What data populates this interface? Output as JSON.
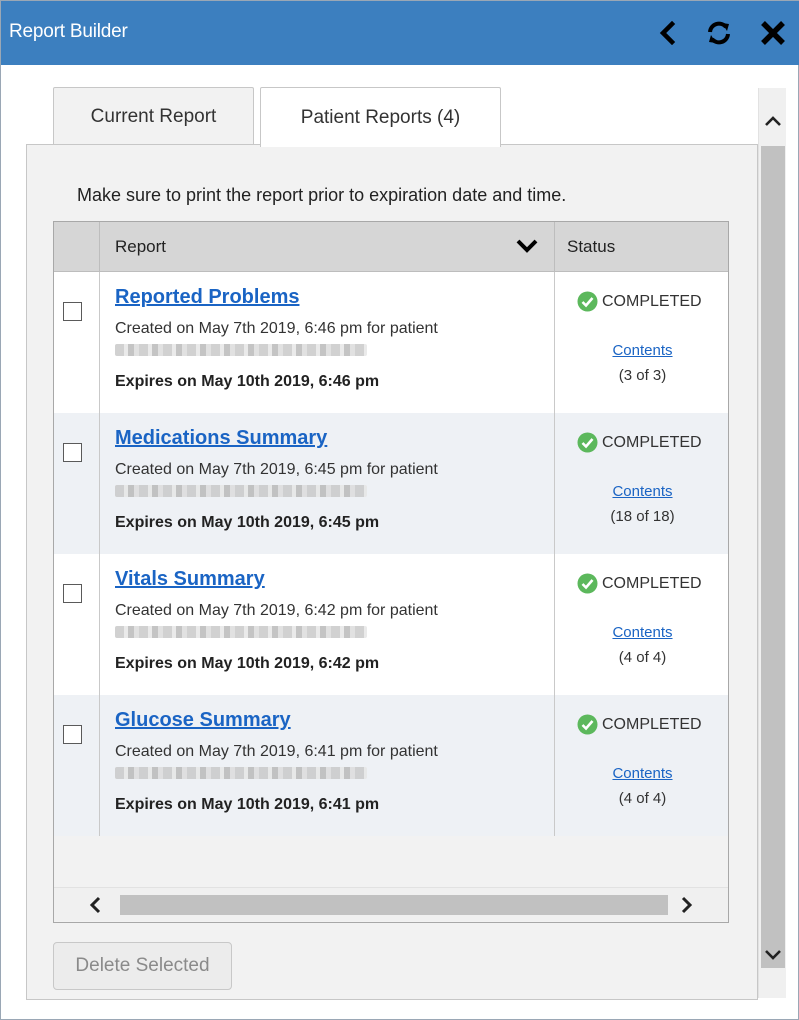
{
  "window": {
    "title": "Report Builder",
    "header_bg": "#3c7fbf",
    "icons": [
      "chevron-left-icon",
      "refresh-icon",
      "close-icon"
    ]
  },
  "tabs": [
    {
      "label": "Current Report",
      "active": false
    },
    {
      "label": "Patient Reports (4)",
      "active": true
    }
  ],
  "notice": "Make sure to print the report prior to expiration date and time.",
  "table": {
    "columns": {
      "report": "Report",
      "status": "Status"
    },
    "rows": [
      {
        "title": "Reported Problems",
        "created": "Created on May 7th 2019, 6:46 pm for patient",
        "expires": "Expires on May 10th 2019, 6:46 pm",
        "status": "COMPLETED",
        "contents_label": "Contents",
        "count": "(3 of 3)",
        "checked": false
      },
      {
        "title": "Medications Summary",
        "created": "Created on May 7th 2019, 6:45 pm for patient",
        "expires": "Expires on May 10th 2019, 6:45 pm",
        "status": "COMPLETED",
        "contents_label": "Contents",
        "count": "(18 of 18)",
        "checked": false
      },
      {
        "title": "Vitals Summary",
        "created": "Created on May 7th 2019, 6:42 pm for patient",
        "expires": "Expires on May 10th 2019, 6:42 pm",
        "status": "COMPLETED",
        "contents_label": "Contents",
        "count": "(4 of 4)",
        "checked": false
      },
      {
        "title": "Glucose Summary",
        "created": "Created on May 7th 2019, 6:41 pm for patient",
        "expires": "Expires on May 10th 2019, 6:41 pm",
        "status": "COMPLETED",
        "contents_label": "Contents",
        "count": "(4 of 4)",
        "checked": false
      }
    ]
  },
  "actions": {
    "delete_label": "Delete Selected",
    "delete_enabled": false
  },
  "colors": {
    "link": "#1a64c4",
    "status_ok": "#5cb85c"
  }
}
